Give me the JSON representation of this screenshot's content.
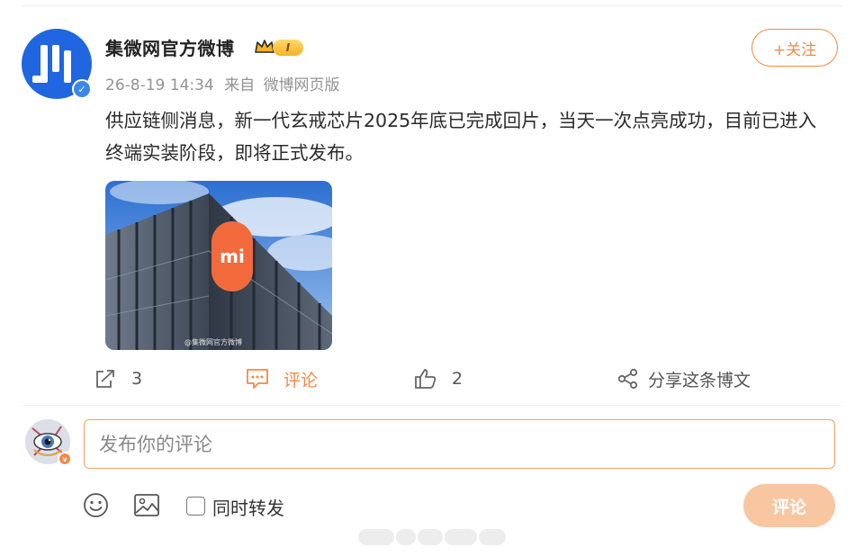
{
  "post": {
    "author_name": "集微网官方微博",
    "author_level": "I",
    "timestamp": "26-8-19 14:34",
    "source_prefix": "来自",
    "source": "微博网页版",
    "follow_label": "+关注",
    "text": "供应链侧消息，新一代玄戒芯片2025年底已完成回片，当天一次点亮成功，目前已进入终端实装阶段，即将正式发布。",
    "image_watermark": "@集微网官方微博",
    "image_logo_text": "mi"
  },
  "actions": {
    "repost_count": "3",
    "comment_label": "评论",
    "like_count": "2",
    "share_label": "分享这条博文"
  },
  "composer": {
    "placeholder": "发布你的评论",
    "repost_label": "同时转发",
    "submit_label": "评论"
  },
  "colors": {
    "accent": "#f08b46",
    "verified_blue": "#3b88e8",
    "submit_disabled": "#f8c6a1",
    "avatar_blue": "#1f66e0"
  },
  "icons": [
    "verified-icon",
    "crown-icon",
    "repost-icon",
    "comment-icon",
    "like-icon",
    "share-icon",
    "emoji-icon",
    "image-icon"
  ]
}
